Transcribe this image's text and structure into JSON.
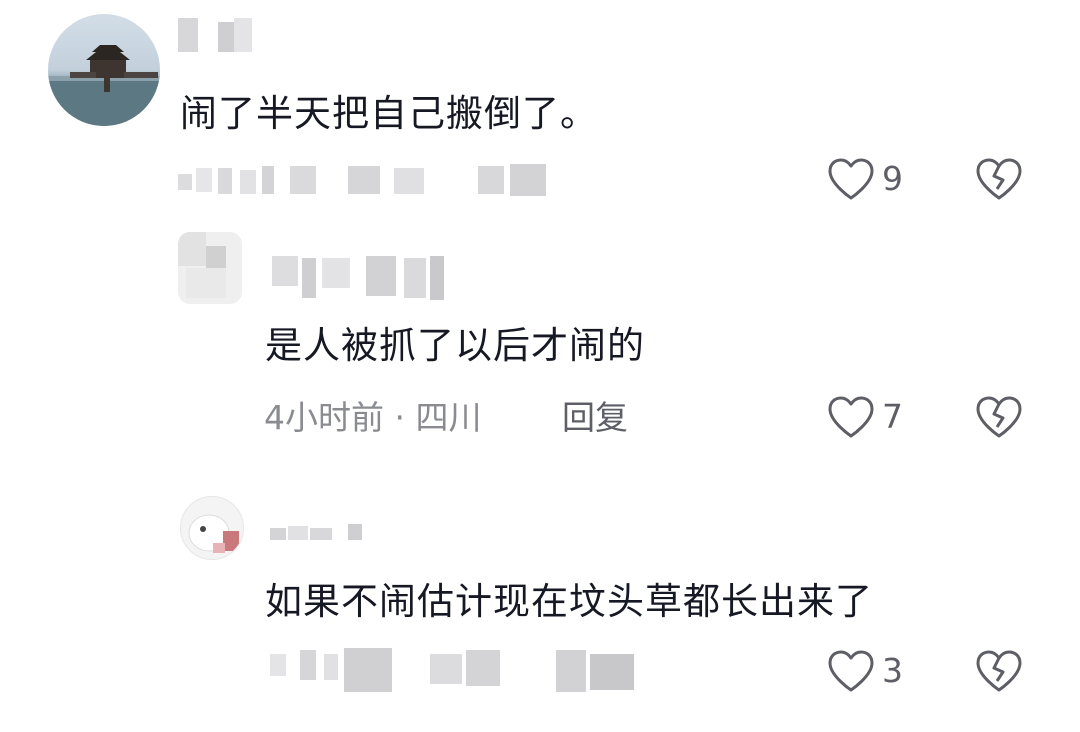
{
  "comments": [
    {
      "text": "闹了半天把自己搬倒了。",
      "like_count": "9"
    },
    {
      "text": "是人被抓了以后才闹的",
      "time": "4小时前",
      "location": "四川",
      "reply_label": "回复",
      "like_count": "7"
    },
    {
      "text": "如果不闹估计现在坟头草都长出来了",
      "like_count": "3"
    }
  ],
  "icons": {
    "like": "heart-outline-icon",
    "dislike": "broken-heart-icon"
  },
  "colors": {
    "text": "#161823",
    "meta": "#8a8b91",
    "icon": "#5e5f66"
  }
}
